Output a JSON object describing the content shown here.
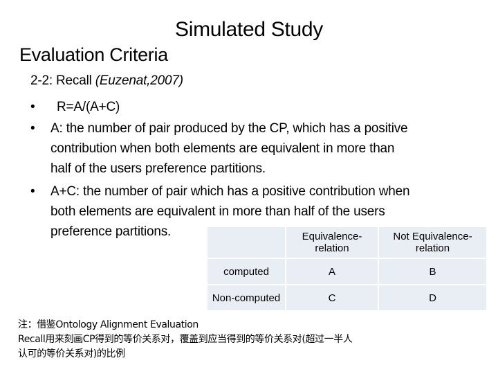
{
  "slide": {
    "title": "Simulated Study",
    "subtitle": "Evaluation Criteria",
    "heading": {
      "prefix": "2-2: Recall ",
      "citation": "(Euzenat,2007)"
    },
    "bullets": [
      {
        "lines": [
          "R=A/(A+C)"
        ]
      },
      {
        "lines": [
          "A: the number of pair produced by the CP, which has a positive",
          "contribution when both elements are equivalent in more than",
          "half of the users preference partitions."
        ]
      },
      {
        "lines": [
          "A+C: the number of pair which has a positive contribution when",
          "both elements are equivalent in more than half of the users",
          "preference partitions."
        ]
      }
    ],
    "bullet_glyph": "•"
  },
  "table": {
    "columns": [
      "",
      "Equivalence-relation",
      "Not Equivalence-relation"
    ],
    "column_lines": [
      [
        "",
        ""
      ],
      [
        "Equivalence-",
        "relation"
      ],
      [
        "Not Equivalence-",
        "relation"
      ]
    ],
    "rows": [
      {
        "label": "computed",
        "cells": [
          "A",
          "B"
        ]
      },
      {
        "label": "Non-computed",
        "cells": [
          "C",
          "D"
        ]
      }
    ]
  },
  "note": {
    "lines": [
      "注：借鉴Ontology Alignment Evaluation",
      "Recall用来刻画CP得到的等价关系对，覆盖到应当得到的等价关系对(超过一半人",
      "认可的等价关系对)的比例"
    ]
  }
}
